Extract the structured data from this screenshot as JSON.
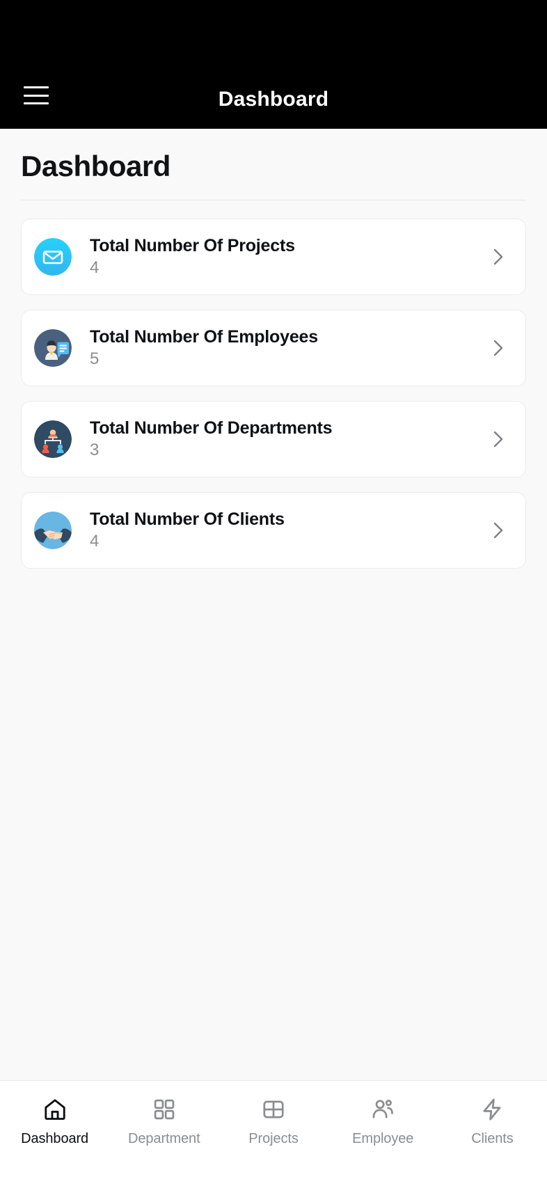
{
  "appbar": {
    "title": "Dashboard",
    "menu_icon": "hamburger-menu-icon",
    "background": "#000000",
    "text_color": "#ffffff"
  },
  "page": {
    "heading": "Dashboard",
    "background": "#f9f9fa"
  },
  "cards": [
    {
      "title": "Total Number Of Projects",
      "value": "4",
      "icon": "mail-envelope-icon",
      "icon_bg": "#29c5f6",
      "chevron": "chevron-right-icon"
    },
    {
      "title": "Total Number Of Employees",
      "value": "5",
      "icon": "employee-profile-icon",
      "icon_bg": "#3d5573",
      "chevron": "chevron-right-icon"
    },
    {
      "title": "Total Number Of Departments",
      "value": "3",
      "icon": "org-chart-icon",
      "icon_bg": "#2f4961",
      "chevron": "chevron-right-icon"
    },
    {
      "title": "Total Number Of Clients",
      "value": "4",
      "icon": "handshake-icon",
      "icon_bg": "#64b4e2",
      "chevron": "chevron-right-icon"
    }
  ],
  "bottom_nav": {
    "active_index": 0,
    "active_color": "#0d0e10",
    "inactive_color": "#8a8c90",
    "items": [
      {
        "label": "Dashboard",
        "icon": "home-icon"
      },
      {
        "label": "Department",
        "icon": "grid-squares-icon"
      },
      {
        "label": "Projects",
        "icon": "table-layout-icon"
      },
      {
        "label": "Employee",
        "icon": "people-icon"
      },
      {
        "label": "Clients",
        "icon": "lightning-bolt-icon"
      }
    ]
  }
}
